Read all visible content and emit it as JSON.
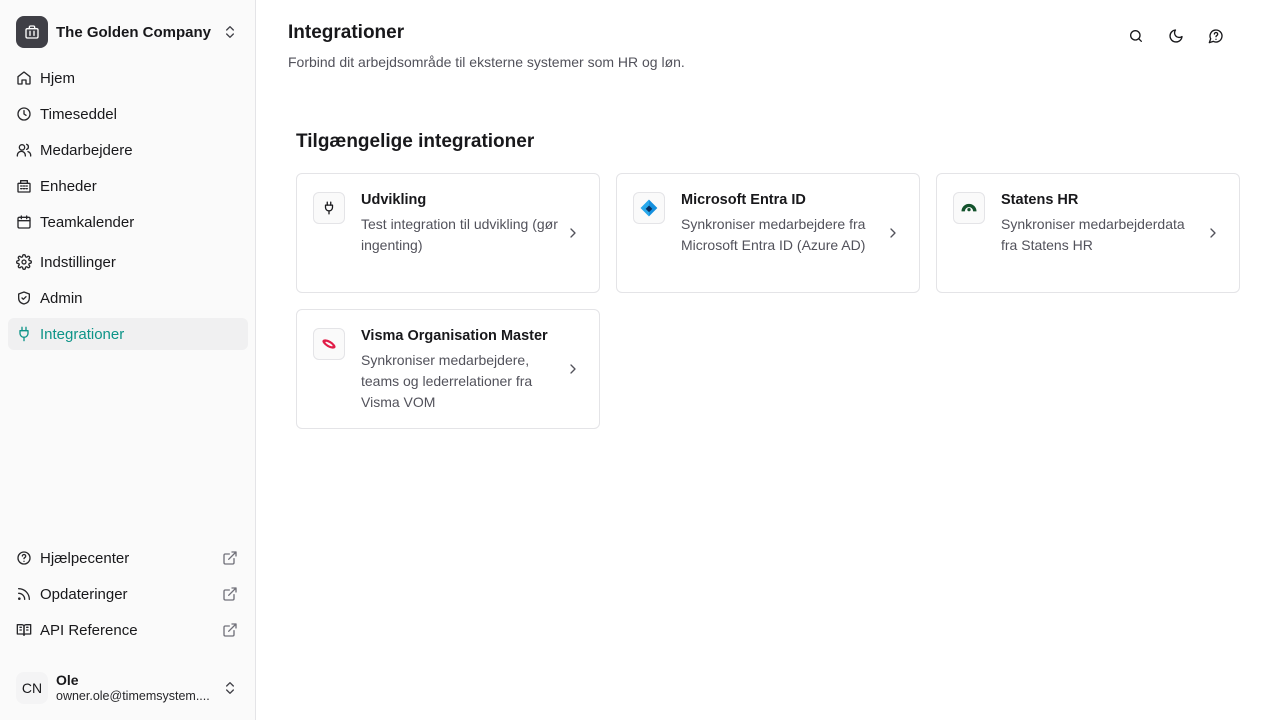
{
  "sidebar": {
    "company": "The Golden Company",
    "nav": [
      {
        "label": "Hjem",
        "icon": "house-icon"
      },
      {
        "label": "Timeseddel",
        "icon": "clock-icon"
      },
      {
        "label": "Medarbejdere",
        "icon": "users-icon"
      },
      {
        "label": "Enheder",
        "icon": "building-icon"
      },
      {
        "label": "Teamkalender",
        "icon": "calendar-icon"
      },
      {
        "label": "Indstillinger",
        "icon": "gear-icon"
      },
      {
        "label": "Admin",
        "icon": "shield-check-icon"
      },
      {
        "label": "Integrationer",
        "icon": "plug-icon",
        "active": true
      }
    ],
    "bottom": [
      {
        "label": "Hjælpecenter",
        "icon": "help-circle-icon"
      },
      {
        "label": "Opdateringer",
        "icon": "rss-icon"
      },
      {
        "label": "API Reference",
        "icon": "book-icon"
      }
    ],
    "user": {
      "initials": "CN",
      "name": "Ole",
      "email": "owner.ole@timemsystem...."
    }
  },
  "header": {
    "title": "Integrationer",
    "description": "Forbind dit arbejdsområde til eksterne systemer som HR og løn."
  },
  "section": {
    "title": "Tilgængelige integrationer"
  },
  "integrations": [
    {
      "name": "Udvikling",
      "description": "Test integration til udvikling (gør ingenting)",
      "icon": "plug-icon"
    },
    {
      "name": "Microsoft Entra ID",
      "description": "Synkroniser medarbejdere fra Microsoft Entra ID (Azure AD)",
      "icon": "entra-id-logo"
    },
    {
      "name": "Statens HR",
      "description": "Synkroniser medarbejderdata fra Statens HR",
      "icon": "statens-hr-logo"
    },
    {
      "name": "Visma Organisation Master",
      "description": "Synkroniser medarbejdere, teams og lederrelationer fra Visma VOM",
      "icon": "visma-logo"
    }
  ],
  "colors": {
    "accent": "#0d9488",
    "text": "#18181b",
    "muted": "#52525b",
    "border": "#e4e4e7"
  }
}
